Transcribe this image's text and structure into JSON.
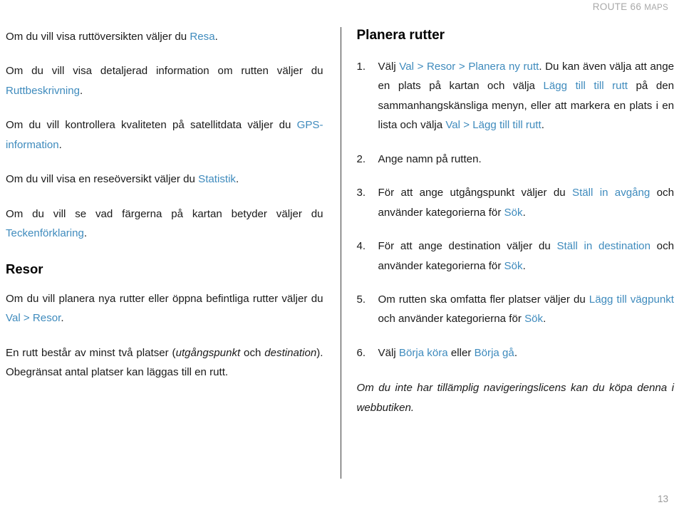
{
  "header": {
    "brand_main": "ROUTE 66 ",
    "brand_smallcaps": "MAPS"
  },
  "footer": {
    "page_number": "13"
  },
  "colors": {
    "link": "#3f8bbd",
    "body_text": "#1a1a1a",
    "header_text": "#a9a9a9",
    "divider": "#3a3a3a",
    "background": "#ffffff"
  },
  "left_column": {
    "paragraphs": [
      {
        "id": "p-ruttoversikt",
        "segments": [
          {
            "text": "Om du vill visa ruttöversikten väljer du ",
            "style": "plain"
          },
          {
            "text": "Resa",
            "style": "link"
          },
          {
            "text": ".",
            "style": "plain"
          }
        ]
      },
      {
        "id": "p-ruttbeskrivning",
        "segments": [
          {
            "text": "Om du vill visa detaljerad information om rutten väljer du ",
            "style": "plain"
          },
          {
            "text": "Ruttbeskrivning",
            "style": "link"
          },
          {
            "text": ".",
            "style": "plain"
          }
        ]
      },
      {
        "id": "p-gps-information",
        "segments": [
          {
            "text": "Om du vill kontrollera kvaliteten på satellitdata väljer du ",
            "style": "plain"
          },
          {
            "text": "GPS-information",
            "style": "link"
          },
          {
            "text": ".",
            "style": "plain"
          }
        ]
      },
      {
        "id": "p-statistik",
        "segments": [
          {
            "text": "Om du vill visa en reseöversikt väljer du ",
            "style": "plain"
          },
          {
            "text": "Statistik",
            "style": "link"
          },
          {
            "text": ".",
            "style": "plain"
          }
        ]
      },
      {
        "id": "p-teckenforklaring",
        "segments": [
          {
            "text": "Om du vill se vad färgerna på kartan betyder väljer du ",
            "style": "plain"
          },
          {
            "text": "Teckenförklaring",
            "style": "link"
          },
          {
            "text": ".",
            "style": "plain"
          }
        ]
      }
    ],
    "section_heading": "Resor",
    "after_heading_paragraphs": [
      {
        "id": "p-planera-nya-rutter",
        "segments": [
          {
            "text": "Om du vill planera nya rutter eller öppna befintliga rutter väljer du ",
            "style": "plain"
          },
          {
            "text": "Val > Resor",
            "style": "link"
          },
          {
            "text": ".",
            "style": "plain"
          }
        ]
      },
      {
        "id": "p-en-rutt-bestar",
        "segments": [
          {
            "text": "En rutt består av minst två platser (",
            "style": "plain"
          },
          {
            "text": "utgångspunkt",
            "style": "italic"
          },
          {
            "text": " och ",
            "style": "plain"
          },
          {
            "text": "destination",
            "style": "italic"
          },
          {
            "text": "). Obegränsat antal platser kan läggas till en rutt.",
            "style": "plain"
          }
        ]
      }
    ]
  },
  "right_column": {
    "heading": "Planera rutter",
    "steps": [
      {
        "number": "1",
        "segments": [
          {
            "text": "Välj ",
            "style": "plain"
          },
          {
            "text": "Val > Resor > Planera ny rutt",
            "style": "link"
          },
          {
            "text": ". Du kan även välja att ange en plats på kartan och välja ",
            "style": "plain"
          },
          {
            "text": "Lägg till till rutt",
            "style": "link"
          },
          {
            "text": " på den sammanhangskänsliga menyn, eller att markera en plats i en lista och välja ",
            "style": "plain"
          },
          {
            "text": "Val > Lägg till till rutt",
            "style": "link"
          },
          {
            "text": ".",
            "style": "plain"
          }
        ]
      },
      {
        "number": "2",
        "segments": [
          {
            "text": "Ange namn på rutten.",
            "style": "plain"
          }
        ]
      },
      {
        "number": "3",
        "segments": [
          {
            "text": "För att ange utgångspunkt väljer du ",
            "style": "plain"
          },
          {
            "text": "Ställ in avgång",
            "style": "link"
          },
          {
            "text": " och använder kategorierna för ",
            "style": "plain"
          },
          {
            "text": "Sök",
            "style": "link"
          },
          {
            "text": ".",
            "style": "plain"
          }
        ]
      },
      {
        "number": "4",
        "segments": [
          {
            "text": "För att ange destination väljer du ",
            "style": "plain"
          },
          {
            "text": "Ställ in destination",
            "style": "link"
          },
          {
            "text": " och använder kategorierna för ",
            "style": "plain"
          },
          {
            "text": "Sök",
            "style": "link"
          },
          {
            "text": ".",
            "style": "plain"
          }
        ]
      },
      {
        "number": "5",
        "segments": [
          {
            "text": "Om rutten ska omfatta fler platser väljer du ",
            "style": "plain"
          },
          {
            "text": "Lägg till vägpunkt",
            "style": "link"
          },
          {
            "text": " och använder kategorierna för ",
            "style": "plain"
          },
          {
            "text": "Sök",
            "style": "link"
          },
          {
            "text": ".",
            "style": "plain"
          }
        ]
      },
      {
        "number": "6",
        "segments": [
          {
            "text": "Välj ",
            "style": "plain"
          },
          {
            "text": "Börja köra",
            "style": "link"
          },
          {
            "text": " eller ",
            "style": "plain"
          },
          {
            "text": "Börja gå",
            "style": "link"
          },
          {
            "text": ".",
            "style": "plain"
          }
        ]
      }
    ],
    "closing_note": "Om du inte har tillämplig navigeringslicens kan du köpa denna i webbutiken."
  }
}
